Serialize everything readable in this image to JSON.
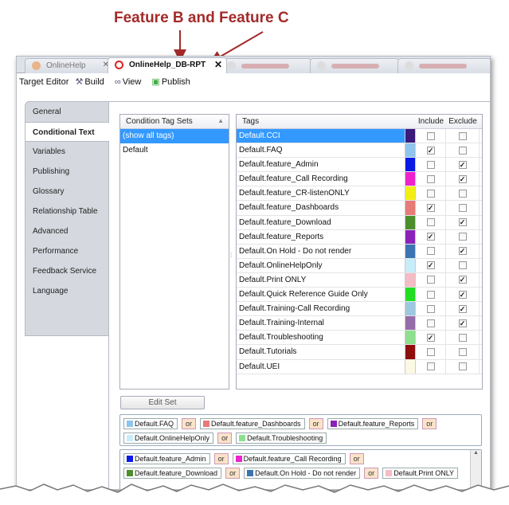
{
  "annotation": {
    "title": "Feature B and Feature C",
    "color": "#a32a2a"
  },
  "tabs": [
    {
      "label": "OnlineHelp",
      "active": false
    },
    {
      "label": "OnlineHelp_DB-RPT",
      "active": true
    }
  ],
  "toolbar": {
    "target_editor": "Target Editor",
    "build": "Build",
    "view": "View",
    "publish": "Publish"
  },
  "sidebar": {
    "items": [
      {
        "label": "General"
      },
      {
        "label": "Conditional Text",
        "active": true
      },
      {
        "label": "Variables"
      },
      {
        "label": "Publishing"
      },
      {
        "label": "Glossary"
      },
      {
        "label": "Relationship Table"
      },
      {
        "label": "Advanced"
      },
      {
        "label": "Performance"
      },
      {
        "label": "Feedback Service"
      },
      {
        "label": "Language"
      }
    ]
  },
  "condition_sets": {
    "header": "Condition Tag Sets",
    "rows": [
      {
        "label": "(show all tags)",
        "selected": true
      },
      {
        "label": "Default",
        "selected": false
      }
    ]
  },
  "tags": {
    "headers": {
      "tags": "Tags",
      "include": "Include",
      "exclude": "Exclude"
    },
    "rows": [
      {
        "name": "Default.CCI",
        "color": "#3b1a7a",
        "include": false,
        "exclude": false,
        "selected": true
      },
      {
        "name": "Default.FAQ",
        "color": "#8fc4ec",
        "include": true,
        "exclude": false
      },
      {
        "name": "Default.feature_Admin",
        "color": "#0a1ae6",
        "include": false,
        "exclude": true
      },
      {
        "name": "Default.feature_Call Recording",
        "color": "#ee22cc",
        "include": false,
        "exclude": true
      },
      {
        "name": "Default.feature_CR-listenONLY",
        "color": "#f2ee14",
        "include": false,
        "exclude": false
      },
      {
        "name": "Default.feature_Dashboards",
        "color": "#e87a78",
        "include": true,
        "exclude": false
      },
      {
        "name": "Default.feature_Download",
        "color": "#4c8e2c",
        "include": false,
        "exclude": true
      },
      {
        "name": "Default.feature_Reports",
        "color": "#8a22b8",
        "include": true,
        "exclude": false
      },
      {
        "name": "Default.On Hold - Do not render",
        "color": "#3c74b2",
        "include": false,
        "exclude": true
      },
      {
        "name": "Default.OnlineHelpOnly",
        "color": "#c8ecf8",
        "include": true,
        "exclude": false
      },
      {
        "name": "Default.Print ONLY",
        "color": "#f4bcc4",
        "include": false,
        "exclude": true
      },
      {
        "name": "Default.Quick Reference Guide Only",
        "color": "#22dd22",
        "include": false,
        "exclude": true
      },
      {
        "name": "Default.Training-Call Recording",
        "color": "#9ec8e0",
        "include": false,
        "exclude": true
      },
      {
        "name": "Default.Training-Internal",
        "color": "#946ca8",
        "include": false,
        "exclude": true
      },
      {
        "name": "Default.Troubleshooting",
        "color": "#8ee08e",
        "include": true,
        "exclude": false
      },
      {
        "name": "Default.Tutorials",
        "color": "#8e0e0e",
        "include": false,
        "exclude": false
      },
      {
        "name": "Default.UEI",
        "color": "#fcf8e4",
        "include": false,
        "exclude": false
      }
    ]
  },
  "edit_set_label": "Edit Set",
  "include_expression": {
    "or_label": "or",
    "chips": [
      {
        "label": "Default.FAQ",
        "color": "#8fc4ec"
      },
      {
        "label": "Default.feature_Dashboards",
        "color": "#e87a78"
      },
      {
        "label": "Default.feature_Reports",
        "color": "#8a22b8"
      },
      {
        "label": "Default.OnlineHelpOnly",
        "color": "#c8ecf8"
      },
      {
        "label": "Default.Troubleshooting",
        "color": "#8ee08e"
      }
    ]
  },
  "exclude_expression": {
    "or_label": "or",
    "chips": [
      {
        "label": "Default.feature_Admin",
        "color": "#0a1ae6"
      },
      {
        "label": "Default.feature_Call Recording",
        "color": "#ee22cc"
      },
      {
        "label": "Default.feature_Download",
        "color": "#4c8e2c"
      },
      {
        "label": "Default.On Hold - Do not render",
        "color": "#3c74b2"
      },
      {
        "label": "Default.Print ONLY",
        "color": "#f4bcc4"
      }
    ]
  }
}
